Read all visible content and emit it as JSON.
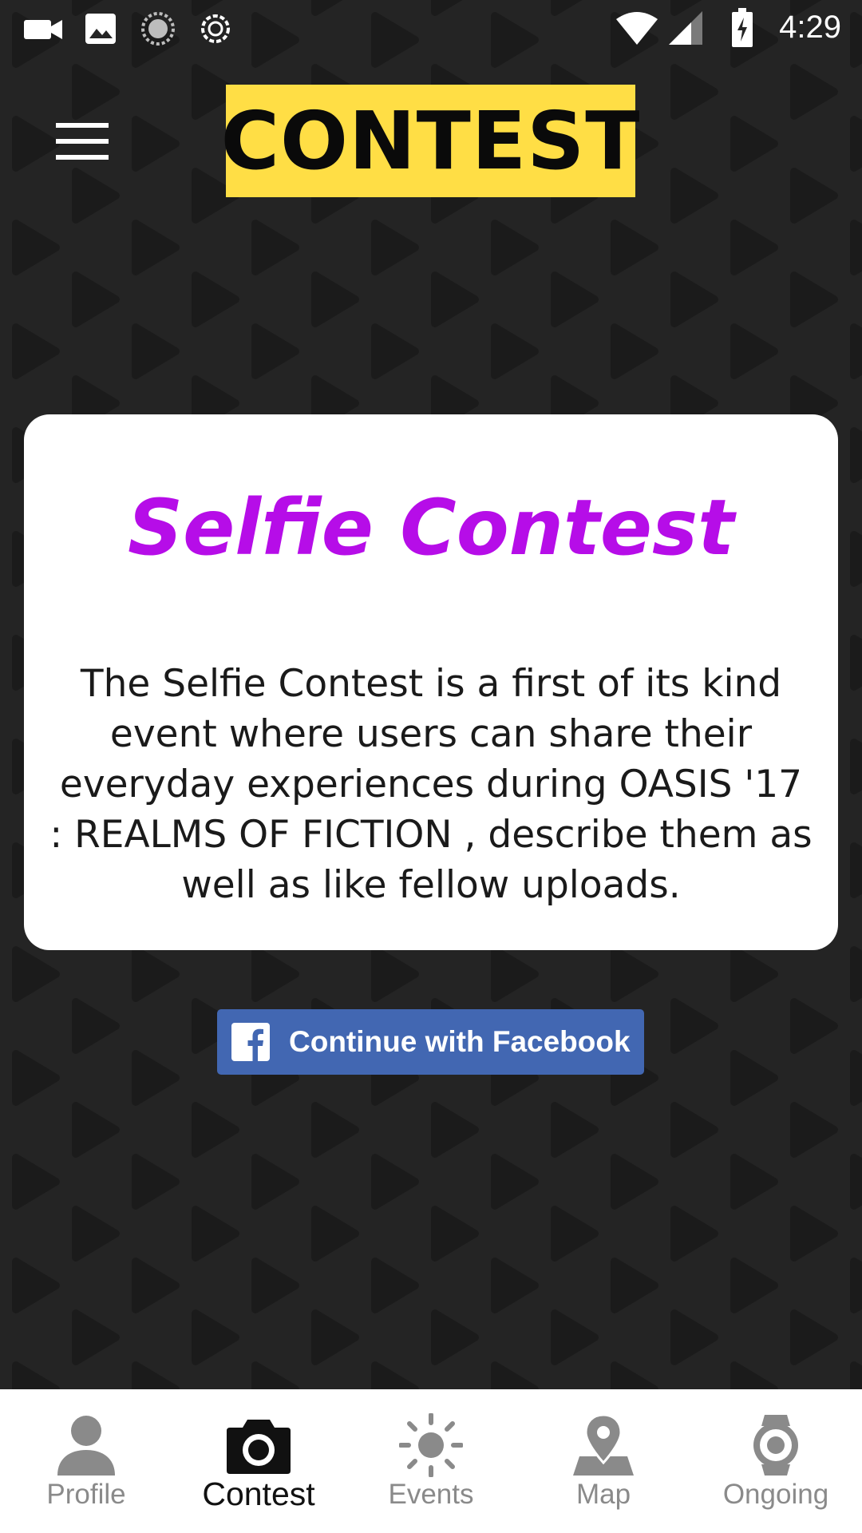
{
  "status_bar": {
    "time": "4:29",
    "icons": [
      "video-camera-icon",
      "image-icon",
      "sync-icon",
      "usb-debug-icon",
      "wifi-icon",
      "signal-icon",
      "battery-charging-icon"
    ]
  },
  "header": {
    "title": "CONTEST",
    "menu_icon": "hamburger-menu-icon"
  },
  "card": {
    "title": "Selfie Contest",
    "description": "The Selfie Contest is a first of its kind event where users can share their everyday experiences during OASIS '17 : REALMS OF FICTION , describe them as well as like fellow uploads."
  },
  "facebook_button": {
    "label": "Continue with Facebook",
    "icon": "facebook-icon"
  },
  "bottom_nav": {
    "items": [
      {
        "label": "Profile",
        "icon": "person-icon",
        "active": false
      },
      {
        "label": "Contest",
        "icon": "camera-icon",
        "active": true
      },
      {
        "label": "Events",
        "icon": "sun-icon",
        "active": false
      },
      {
        "label": "Map",
        "icon": "map-pin-icon",
        "active": false
      },
      {
        "label": "Ongoing",
        "icon": "watch-icon",
        "active": false
      }
    ]
  },
  "colors": {
    "background": "#242424",
    "title_highlight": "#ffde45",
    "card_title": "#b60de8",
    "facebook_blue": "#4267b2",
    "nav_inactive": "#8a8a8a",
    "nav_active": "#111111"
  }
}
